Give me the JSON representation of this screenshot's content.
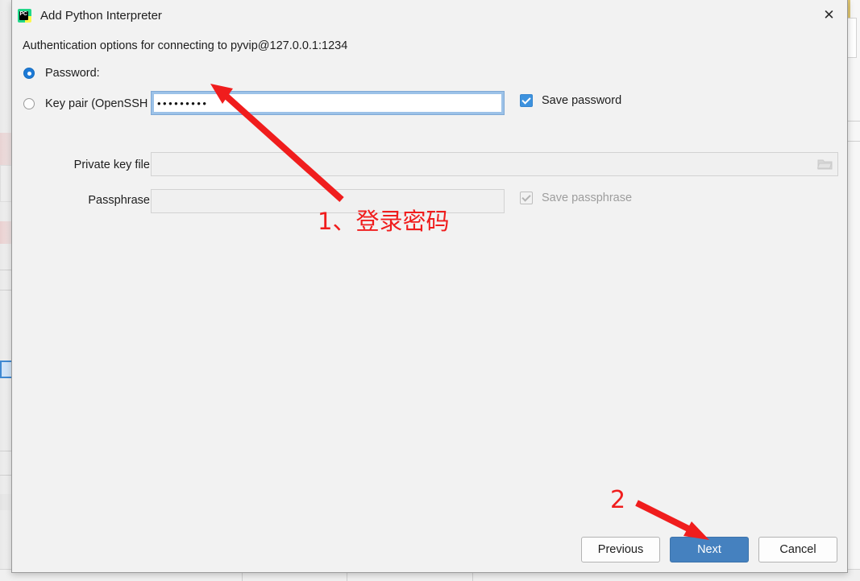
{
  "window": {
    "title": "Add Python Interpreter",
    "app_icon": "pycharm-icon",
    "icon_text": "PC",
    "close_label": "✕"
  },
  "dialog": {
    "subtitle": "Authentication options for connecting to pyvip@127.0.0.1:1234",
    "auth_mode_selected": "password",
    "options": [
      {
        "id": "password",
        "label": "Password:",
        "selected": true
      },
      {
        "id": "keypair",
        "label": "Key pair (OpenSSH or PuTTY):",
        "selected": false
      }
    ],
    "fields": {
      "password": {
        "label": "Password:",
        "value": "•••••••••",
        "placeholder": "",
        "focused": true
      },
      "private_key_file": {
        "label": "Private key file:",
        "value": "",
        "placeholder": "",
        "enabled": false,
        "browse_icon": "folder-icon"
      },
      "passphrase": {
        "label": "Passphrase:",
        "value": "",
        "placeholder": "",
        "enabled": false
      }
    },
    "checkboxes": {
      "save_password": {
        "label": "Save password",
        "checked": true,
        "enabled": true
      },
      "save_passphrase": {
        "label": "Save passphrase",
        "checked": true,
        "enabled": false
      }
    }
  },
  "footer": {
    "previous_label": "Previous",
    "next_label": "Next",
    "cancel_label": "Cancel",
    "default_button": "Next"
  },
  "annotations": {
    "step1": "1、登录密码",
    "step2": "2",
    "color": "#f01d1d"
  },
  "colors": {
    "accent": "#4581bf",
    "selection": "#1d7ad6",
    "checkbox": "#3d92de",
    "dialog_bg": "#f2f2f2",
    "annotation_red": "#f01d1d"
  }
}
